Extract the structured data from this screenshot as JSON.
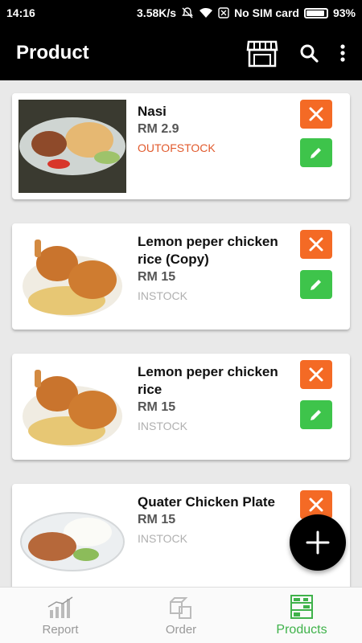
{
  "status_bar": {
    "time": "14:16",
    "speed": "3.58K/s",
    "sim": "No SIM card",
    "battery": "93%"
  },
  "app_bar": {
    "title": "Product",
    "icons": [
      "store-icon",
      "search-icon",
      "more-vert-icon"
    ]
  },
  "products": [
    {
      "name": "Nasi",
      "price": "RM 2.9",
      "stock": "OUTOFSTOCK"
    },
    {
      "name": "Lemon peper chicken rice (Copy)",
      "price": "RM 15",
      "stock": "INSTOCK"
    },
    {
      "name": "Lemon peper chicken rice",
      "price": "RM 15",
      "stock": "INSTOCK"
    },
    {
      "name": "Quater Chicken Plate",
      "price": "RM 15",
      "stock": "INSTOCK"
    }
  ],
  "fab": {
    "icon": "plus-icon"
  },
  "bottom_nav": {
    "items": [
      {
        "label": "Report",
        "icon": "report-chart-icon"
      },
      {
        "label": "Order",
        "icon": "order-boxes-icon"
      },
      {
        "label": "Products",
        "icon": "products-shelf-icon"
      }
    ],
    "active": "Products"
  },
  "colors": {
    "delete": "#f46a25",
    "edit": "#3ec44b",
    "out_of_stock": "#e15a2d",
    "active_nav": "#3fb24a"
  }
}
